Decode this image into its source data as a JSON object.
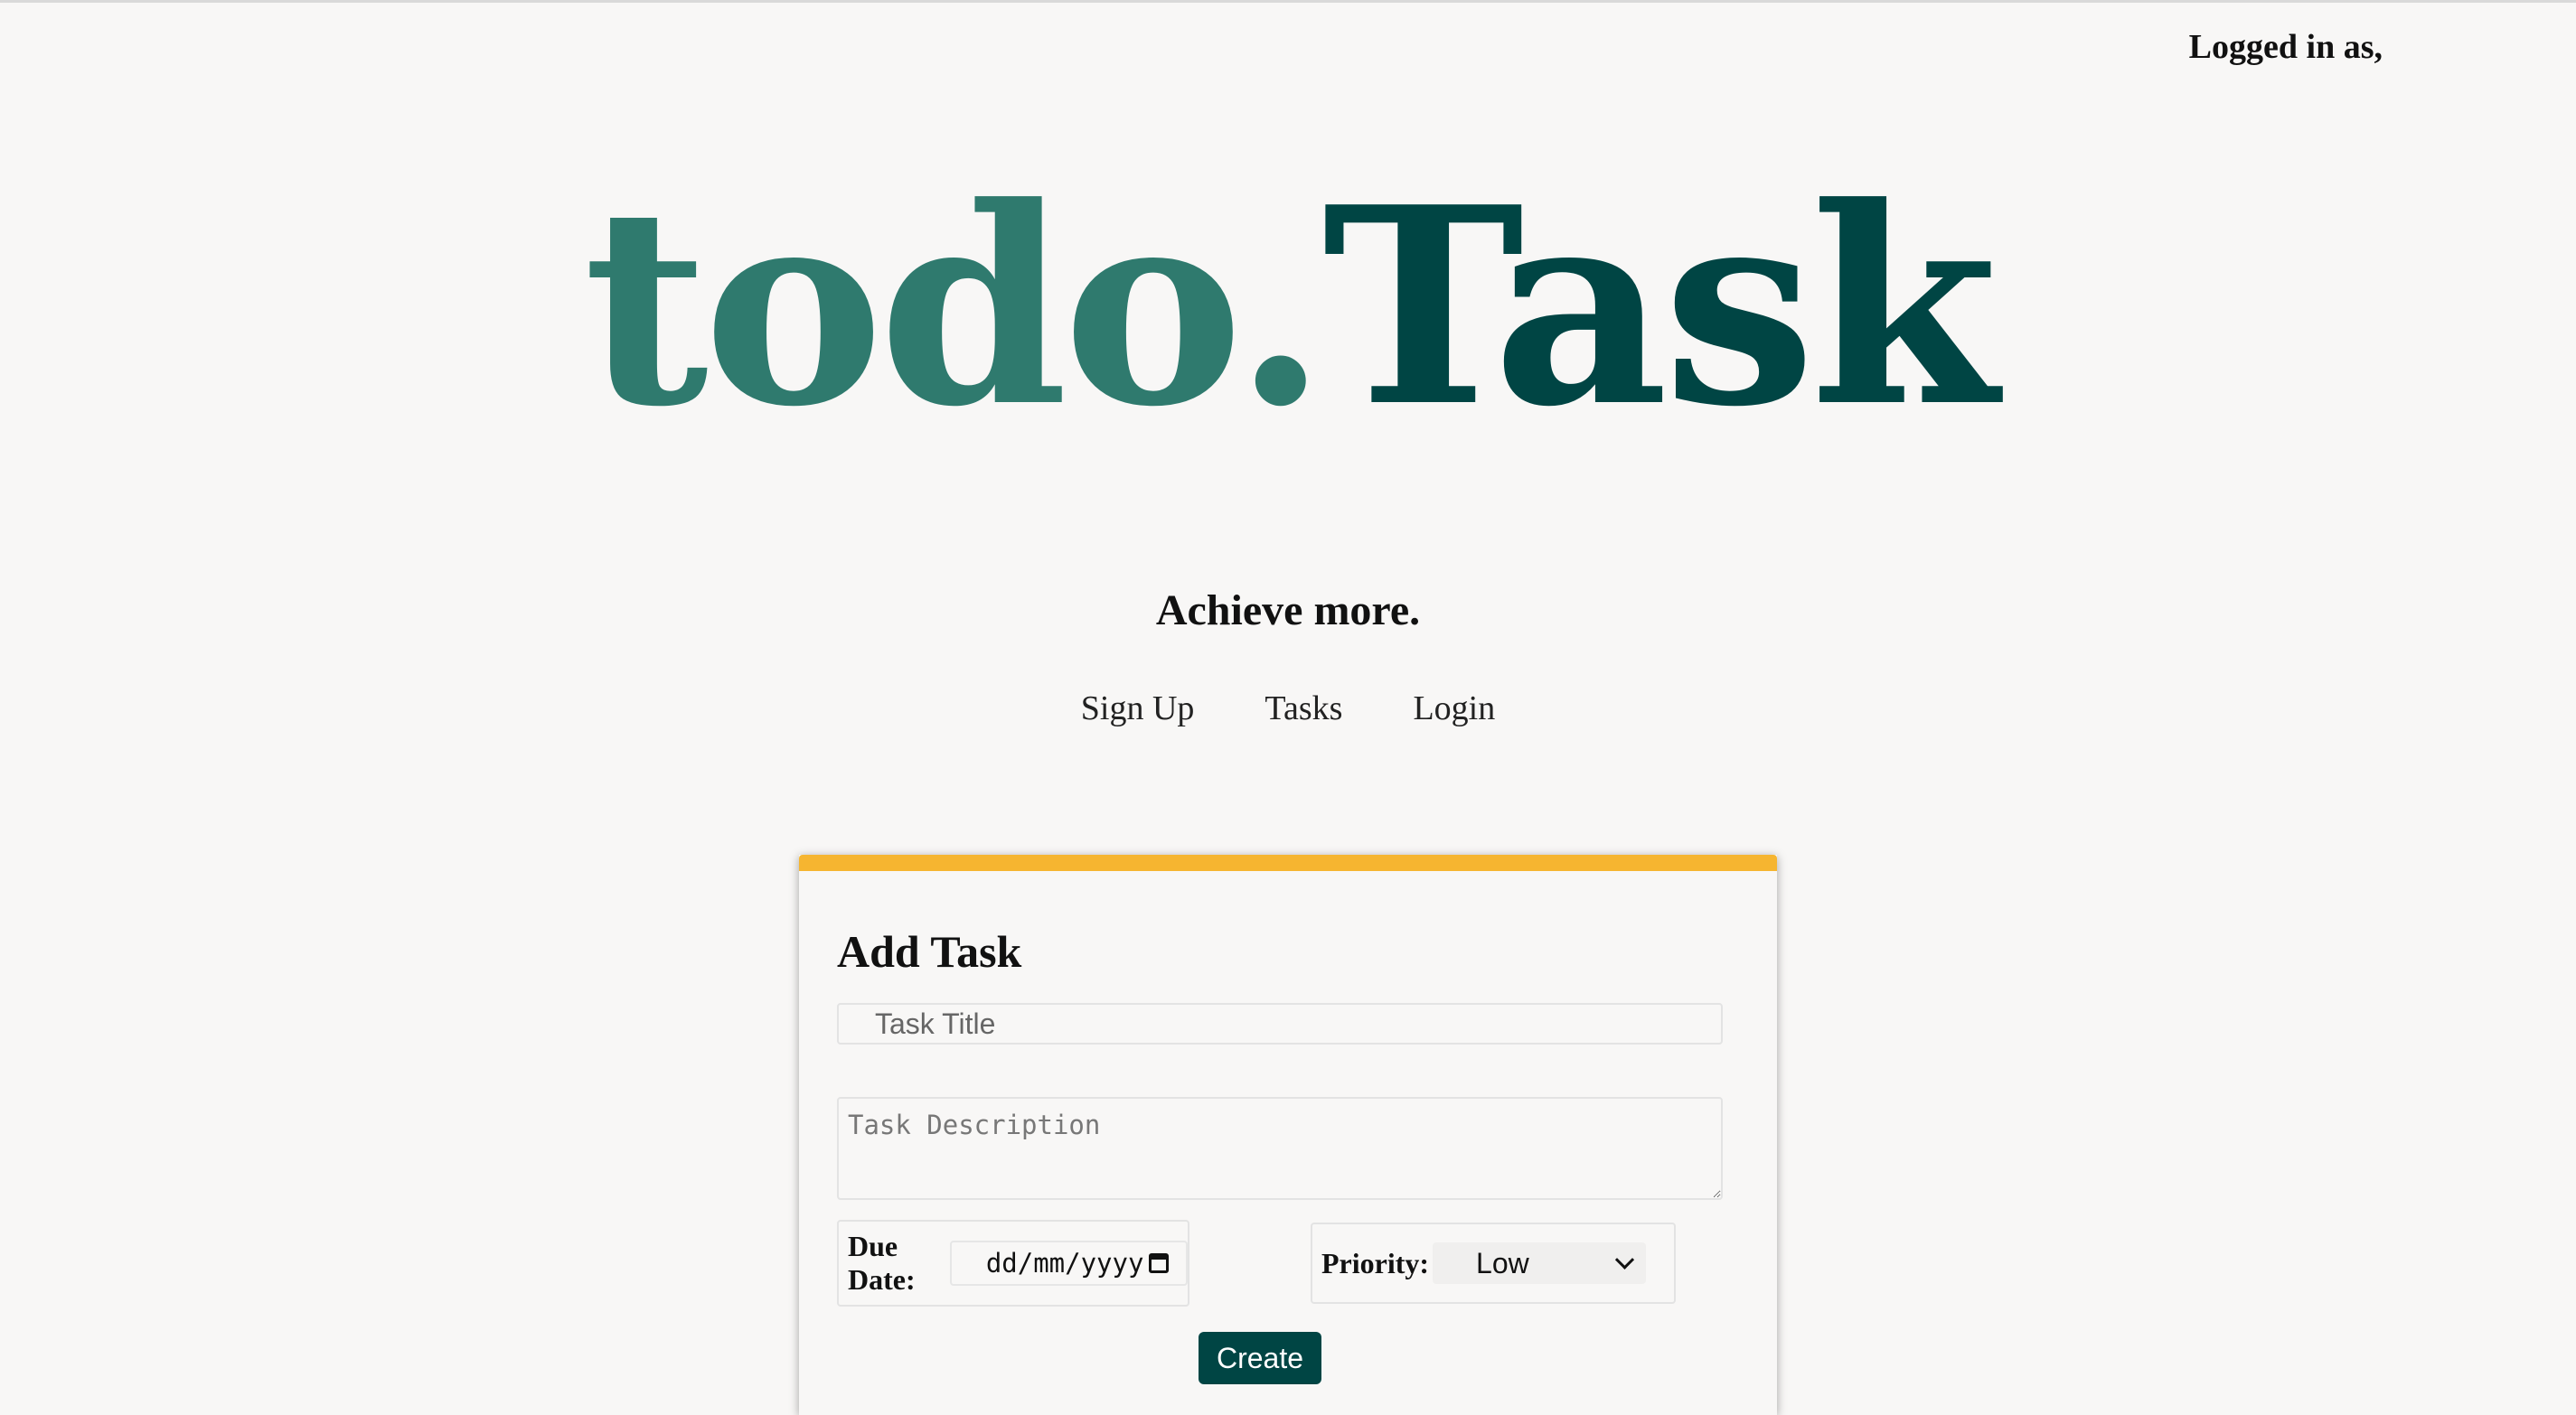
{
  "header": {
    "logged_in_text": "Logged in as,"
  },
  "brand": {
    "logo_part_1": "todo.",
    "logo_part_2": "Task",
    "tagline": "Achieve more.",
    "colors": {
      "logo_primary": "#2f7a6e",
      "logo_dark": "#004544",
      "accent": "#f6b530"
    }
  },
  "nav": {
    "items": [
      {
        "label": "Sign Up"
      },
      {
        "label": "Tasks"
      },
      {
        "label": "Login"
      }
    ]
  },
  "add_task": {
    "heading": "Add Task",
    "title_placeholder": "Task Title",
    "description_placeholder": "Task Description",
    "due_date_label": "Due Date:",
    "due_date_placeholder": "dd/mm/yyyy",
    "priority_label": "Priority:",
    "priority_value": "Low",
    "create_label": "Create"
  }
}
